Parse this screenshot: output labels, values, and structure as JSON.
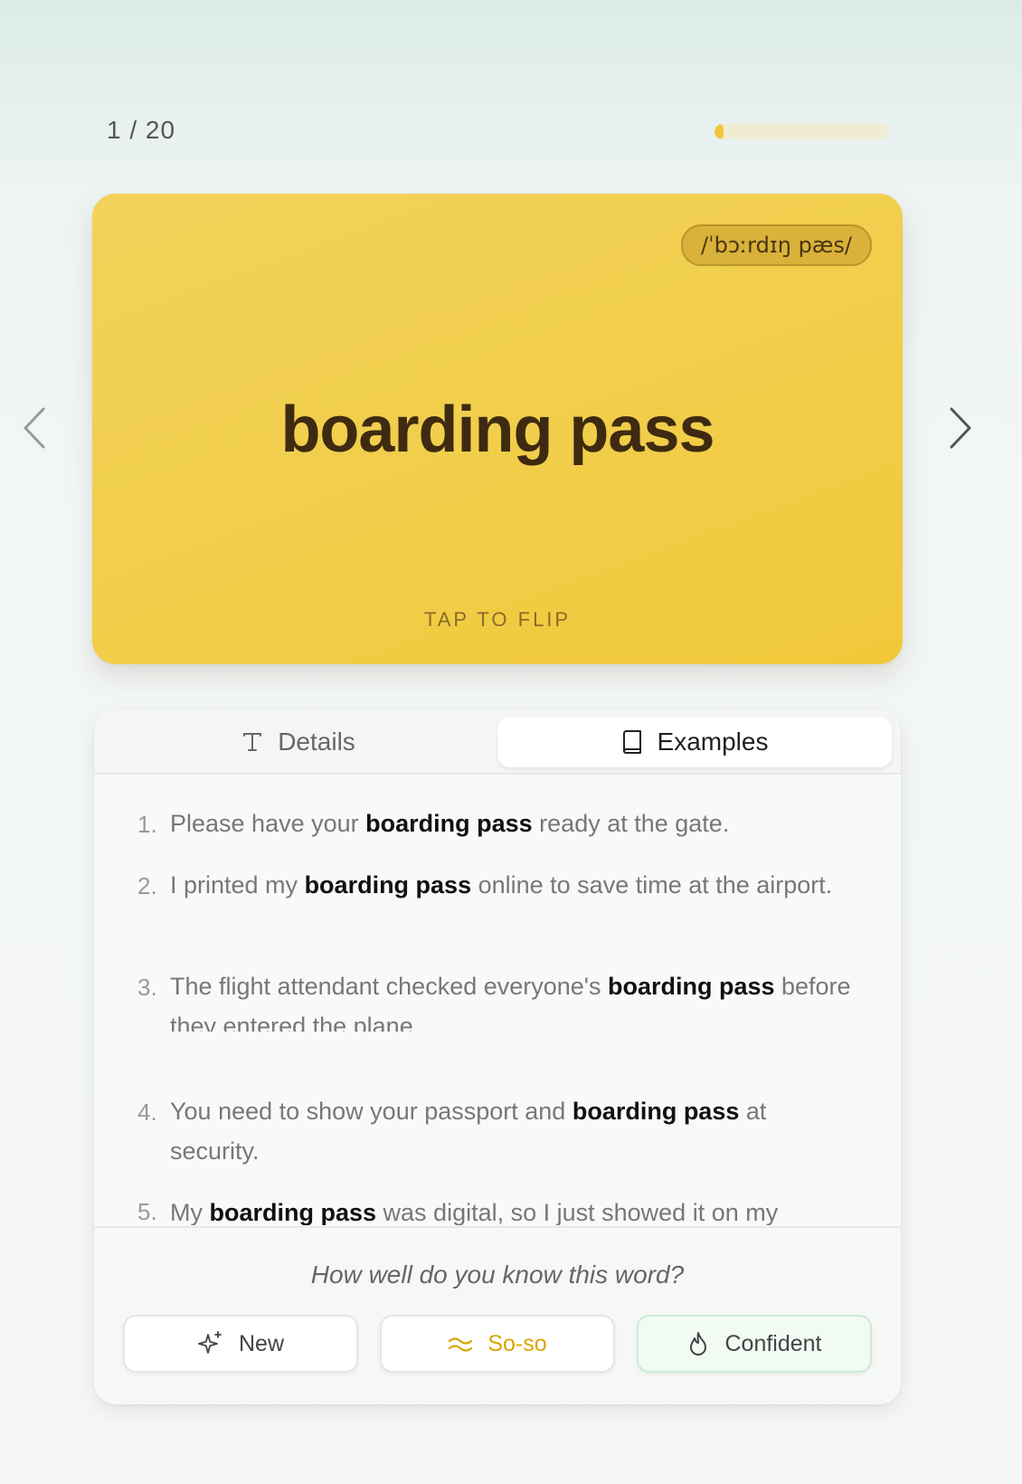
{
  "progress": {
    "counter": "1 / 20",
    "fraction": 0.05
  },
  "card": {
    "phonetic": "/ˈbɔːrdɪŋ pæs/",
    "word": "boarding pass",
    "hint": "TAP TO FLIP",
    "color": "#f1cd48"
  },
  "tabs": {
    "details": {
      "label": "Details",
      "icon": "text-icon"
    },
    "examples": {
      "label": "Examples",
      "icon": "book-icon",
      "active": true
    }
  },
  "examples": [
    {
      "num": "1.",
      "pre": "Please have your ",
      "term": "boarding pass",
      "post": " ready at the gate."
    },
    {
      "num": "2.",
      "pre": "I printed my ",
      "term": "boarding pass",
      "post": " online to save time at the airport."
    },
    {
      "num": "3.",
      "pre": "The flight attendant checked everyone's ",
      "term": "boarding pass",
      "post": " before they entered the plane."
    },
    {
      "num": "4.",
      "pre": "You need to show your passport and ",
      "term": "boarding pass",
      "post": " at security."
    },
    {
      "num": "5.",
      "pre": "My ",
      "term": "boarding pass",
      "post": " was digital, so I just showed it on my"
    }
  ],
  "rating": {
    "question": "How well do you know this word?",
    "buttons": [
      {
        "label": "New",
        "icon": "sparkle-icon"
      },
      {
        "label": "So-so",
        "icon": "wave-icon",
        "color": "#d8a500"
      },
      {
        "label": "Confident",
        "icon": "flame-icon",
        "color": "#f1fbf3"
      }
    ]
  }
}
